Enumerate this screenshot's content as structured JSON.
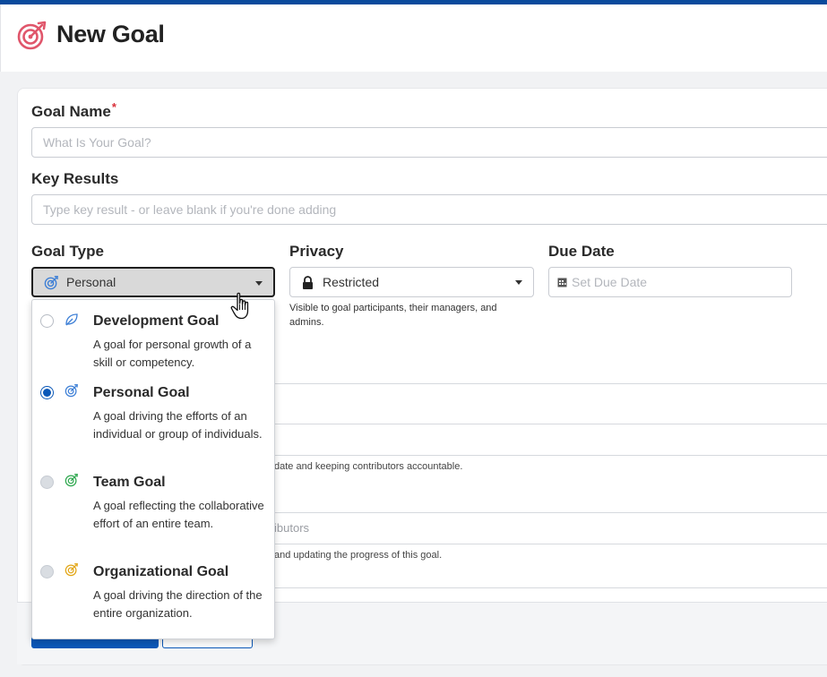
{
  "header": {
    "title": "New Goal"
  },
  "form": {
    "goal_name": {
      "label": "Goal Name",
      "required_mark": "*",
      "placeholder": "What Is Your Goal?"
    },
    "key_results": {
      "label": "Key Results",
      "placeholder": "Type key result - or leave blank if you're done adding"
    },
    "goal_type": {
      "label": "Goal Type",
      "value": "Personal"
    },
    "privacy": {
      "label": "Privacy",
      "value": "Restricted",
      "help": "Visible to goal participants, their managers, and admins."
    },
    "due_date": {
      "label": "Due Date",
      "placeholder": "Set Due Date"
    }
  },
  "obscured": {
    "accountable_help": "date and keeping contributors accountable.",
    "contributors_placeholder": "ibutors",
    "contributors_help": "and updating the progress of this goal."
  },
  "goal_type_options": [
    {
      "title": "Development Goal",
      "description": "A goal for personal growth of a skill or competency.",
      "selected": false,
      "icon": "leaf-icon",
      "color": "#3d7fd6"
    },
    {
      "title": "Personal Goal",
      "description": "A goal driving the efforts of an individual or group of individuals.",
      "selected": true,
      "icon": "target-icon",
      "color": "#3d7fd6"
    },
    {
      "title": "Team Goal",
      "description": "A goal reflecting the collaborative effort of an entire team.",
      "selected": false,
      "icon": "target-icon",
      "color": "#2fa84f"
    },
    {
      "title": "Organizational Goal",
      "description": "A goal driving the direction of the entire organization.",
      "selected": false,
      "icon": "target-icon",
      "color": "#e2a514"
    }
  ],
  "colors": {
    "brand": "#0a4a9c",
    "primary_button": "#0b58b8",
    "header_icon": "#e0566b",
    "required": "#d9303a"
  }
}
